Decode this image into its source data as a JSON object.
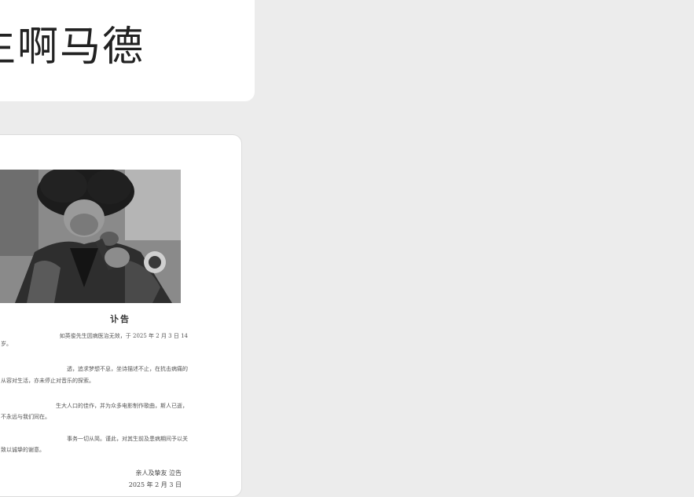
{
  "chat": {
    "message_text": "生啊马德"
  },
  "obituary": {
    "title": "讣告",
    "paragraphs": [
      [
        "如英俊先生因病医治无效，于 2025 年 2 月 3 日 14",
        "岁。"
      ],
      [
        "透，追求梦想不息，坐诗描述不止，在抗击病痛的",
        "从容对生活，亦未停止对音乐的探索。"
      ],
      [
        "生大人口的佳作，并为众多电影制作歌曲，斯人已逝，",
        "不永远与我们同在。"
      ],
      [
        "事务一切从简。谨此，对其生前及患病期间予以关",
        "致以诚挚的谢意。"
      ]
    ],
    "signature": "亲人及挚友  泣告",
    "date": "2025 年 2 月 3 日"
  }
}
